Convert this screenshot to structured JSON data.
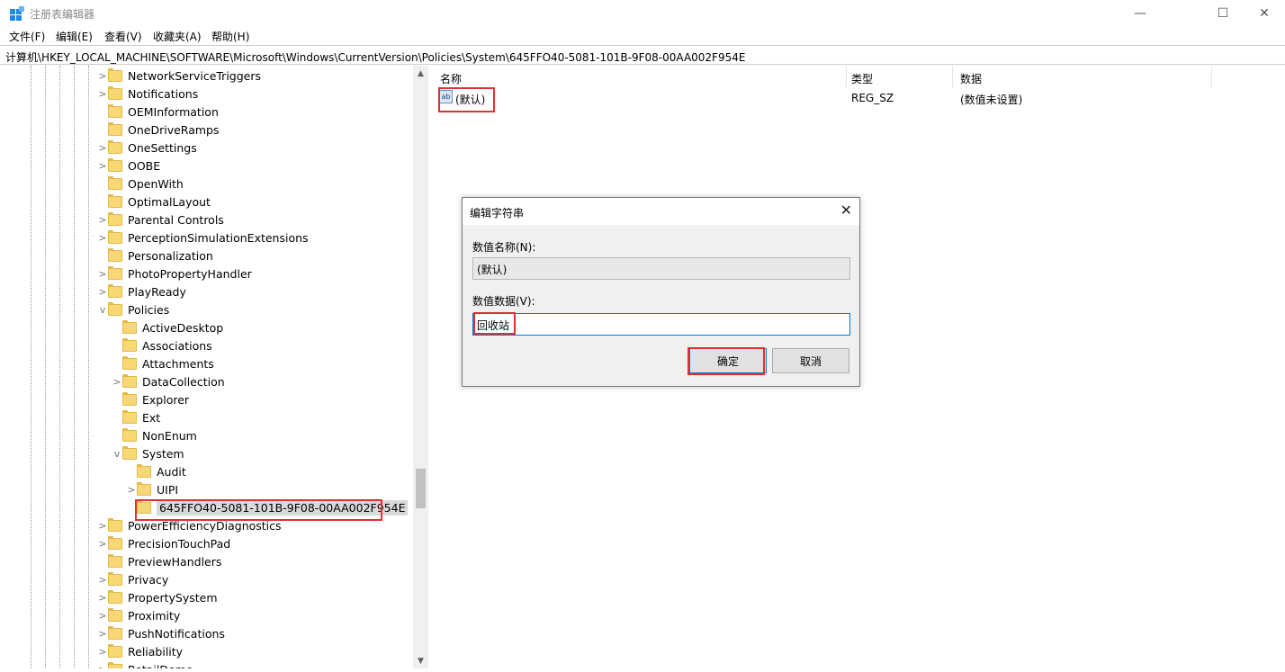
{
  "window": {
    "title": "注册表编辑器",
    "minimize": "—",
    "maximize": "☐",
    "close": "✕"
  },
  "menu": [
    "文件(F)",
    "编辑(E)",
    "查看(V)",
    "收藏夹(A)",
    "帮助(H)"
  ],
  "address": "计算机\\HKEY_LOCAL_MACHINE\\SOFTWARE\\Microsoft\\Windows\\CurrentVersion\\Policies\\System\\645FFO40-5081-101B-9F08-00AA002F954E",
  "tree": [
    {
      "label": "NetworkServiceTriggers",
      "level": 0,
      "chev": ">"
    },
    {
      "label": "Notifications",
      "level": 0,
      "chev": ">"
    },
    {
      "label": "OEMInformation",
      "level": 0,
      "chev": ""
    },
    {
      "label": "OneDriveRamps",
      "level": 0,
      "chev": ""
    },
    {
      "label": "OneSettings",
      "level": 0,
      "chev": ">"
    },
    {
      "label": "OOBE",
      "level": 0,
      "chev": ">"
    },
    {
      "label": "OpenWith",
      "level": 0,
      "chev": ""
    },
    {
      "label": "OptimalLayout",
      "level": 0,
      "chev": ""
    },
    {
      "label": "Parental Controls",
      "level": 0,
      "chev": ">"
    },
    {
      "label": "PerceptionSimulationExtensions",
      "level": 0,
      "chev": ">"
    },
    {
      "label": "Personalization",
      "level": 0,
      "chev": ""
    },
    {
      "label": "PhotoPropertyHandler",
      "level": 0,
      "chev": ">"
    },
    {
      "label": "PlayReady",
      "level": 0,
      "chev": ">"
    },
    {
      "label": "Policies",
      "level": 0,
      "chev": "v"
    },
    {
      "label": "ActiveDesktop",
      "level": 1,
      "chev": ""
    },
    {
      "label": "Associations",
      "level": 1,
      "chev": ""
    },
    {
      "label": "Attachments",
      "level": 1,
      "chev": ""
    },
    {
      "label": "DataCollection",
      "level": 1,
      "chev": ">"
    },
    {
      "label": "Explorer",
      "level": 1,
      "chev": ""
    },
    {
      "label": "Ext",
      "level": 1,
      "chev": ""
    },
    {
      "label": "NonEnum",
      "level": 1,
      "chev": ""
    },
    {
      "label": "System",
      "level": 1,
      "chev": "v"
    },
    {
      "label": "Audit",
      "level": 2,
      "chev": ""
    },
    {
      "label": "UIPI",
      "level": 2,
      "chev": ">"
    },
    {
      "label": "645FFO40-5081-101B-9F08-00AA002F954E",
      "level": 2,
      "chev": "",
      "selected": true
    },
    {
      "label": "PowerEfficiencyDiagnostics",
      "level": 0,
      "chev": ">"
    },
    {
      "label": "PrecisionTouchPad",
      "level": 0,
      "chev": ">"
    },
    {
      "label": "PreviewHandlers",
      "level": 0,
      "chev": ""
    },
    {
      "label": "Privacy",
      "level": 0,
      "chev": ">"
    },
    {
      "label": "PropertySystem",
      "level": 0,
      "chev": ">"
    },
    {
      "label": "Proximity",
      "level": 0,
      "chev": ">"
    },
    {
      "label": "PushNotifications",
      "level": 0,
      "chev": ">"
    },
    {
      "label": "Reliability",
      "level": 0,
      "chev": ">"
    },
    {
      "label": "RetailDemo",
      "level": 0,
      "chev": ">"
    }
  ],
  "list": {
    "headers": {
      "name": "名称",
      "type": "类型",
      "data": "数据"
    },
    "rows": [
      {
        "icon": "ab",
        "name": "(默认)",
        "type": "REG_SZ",
        "data": "(数值未设置)"
      }
    ]
  },
  "dialog": {
    "title": "编辑字符串",
    "name_label": "数值名称(N):",
    "name_value": "(默认)",
    "data_label": "数值数据(V):",
    "data_value": "回收站",
    "ok": "确定",
    "cancel": "取消"
  },
  "colors": {
    "highlight_box": "#e03034",
    "folder": "#f8d775",
    "accent": "#0078d7"
  },
  "icons": [
    "regedit-app-icon",
    "folder-icon",
    "string-value-icon",
    "chevron-icon",
    "close-icon"
  ]
}
